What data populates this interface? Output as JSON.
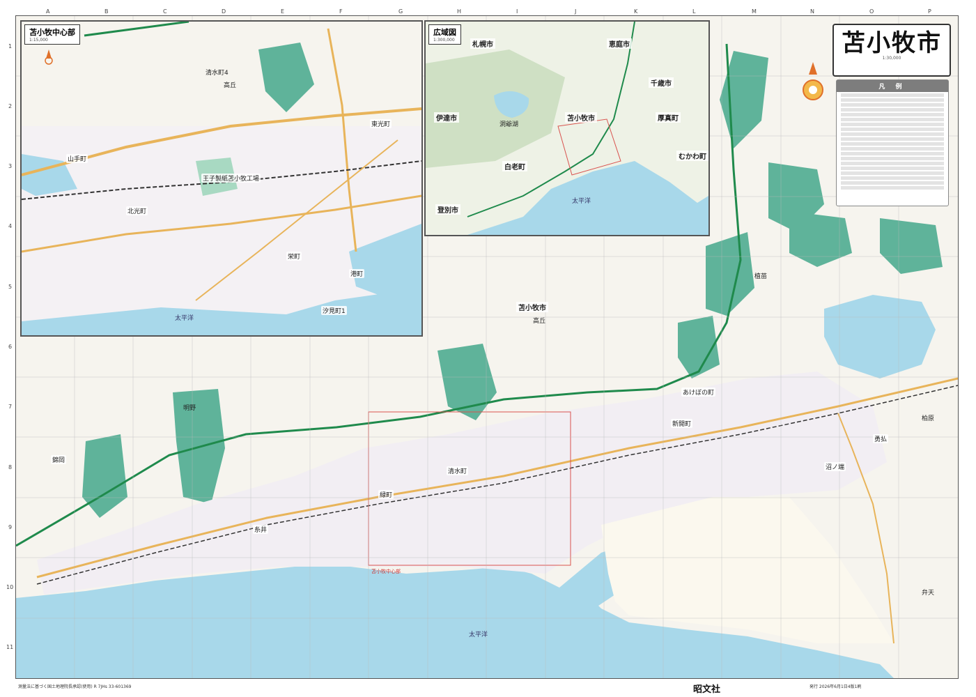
{
  "title": "苫小牧市",
  "title_scale": "1:30,000",
  "inset_center": {
    "title": "苫小牧中心部",
    "scale": "1:15,000"
  },
  "inset_wide": {
    "title": "広域図",
    "scale": "1:300,000"
  },
  "legend_title": "凡 例",
  "publisher": "昭文社",
  "footer_left": "測量法に基づく国土地理院長承認(使用) R 7JHs 33-601369",
  "footer_right": "発行 2026年6月1日4版1刷",
  "colors": {
    "sea": "#a8d8ea",
    "land": "#f6f4ee",
    "green": "#5fb39a",
    "road": "#e8b45a",
    "expressway": "#1f8a4c"
  },
  "col_letters": [
    "A",
    "B",
    "C",
    "D",
    "E",
    "F",
    "G",
    "H",
    "I",
    "J",
    "K",
    "L",
    "M",
    "N",
    "O",
    "P"
  ],
  "row_numbers": [
    "1",
    "2",
    "3",
    "4",
    "5",
    "6",
    "7",
    "8",
    "9",
    "10",
    "11"
  ],
  "inset_labels": {
    "kiyomizu": "清水町4",
    "takaoka": "高丘",
    "oji": "王子製紙苫小牧工場",
    "higashi_hon": "東光町",
    "kita_koyo": "北光町",
    "yamate": "山手町",
    "sakaemachi": "栄町",
    "minato": "港町",
    "taiheiyo": "太平洋",
    "shiomi": "汐見町1"
  },
  "wide_labels": {
    "sapporo": "札幌市",
    "eniwa": "恵庭市",
    "date": "伊達市",
    "shiraoi": "白老町",
    "noboribetsu": "登別市",
    "tomakomai": "苫小牧市",
    "chitose": "千歳市",
    "atsuma": "厚真町",
    "mukawa": "むかわ町",
    "taiheiyo": "太平洋",
    "toya": "洞爺湖"
  },
  "main_labels": {
    "tomakomai": "苫小牧市",
    "takaoka": "高丘",
    "nishikioka": "錦岡",
    "itoi": "糸井",
    "shiraoi_dori": "緑町",
    "kiyomizu": "清水町",
    "yufutsu": "勇払",
    "nuta": "沼ノ端",
    "akebono": "あけぼの町",
    "shinkai": "新開町",
    "taiheiyo": "太平洋",
    "center_box": "苫小牧中心部",
    "benten": "弁天",
    "kashiwabara": "柏原",
    "nagase": "明野",
    "ueno": "植苗"
  }
}
